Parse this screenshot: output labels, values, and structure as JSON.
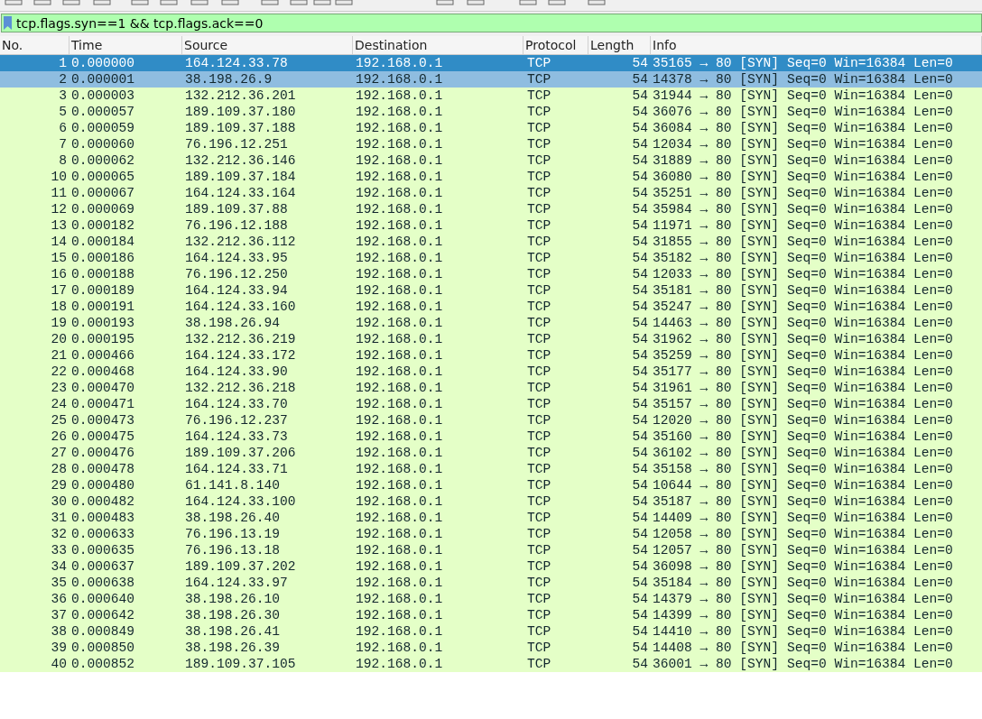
{
  "filter": {
    "value": "tcp.flags.syn==1 && tcp.flags.ack==0"
  },
  "packet_list": {
    "columns": [
      "No.",
      "Time",
      "Source",
      "Destination",
      "Protocol",
      "Length",
      "Info"
    ],
    "rows": [
      {
        "cells": [
          "1",
          "0.000000",
          "164.124.33.78",
          "192.168.0.1",
          "TCP",
          "54",
          "35165 → 80 [SYN] Seq=0 Win=16384 Len=0"
        ],
        "selected": true,
        "hovered": false
      },
      {
        "cells": [
          "2",
          "0.000001",
          "38.198.26.9",
          "192.168.0.1",
          "TCP",
          "54",
          "14378 → 80 [SYN] Seq=0 Win=16384 Len=0"
        ],
        "selected": false,
        "hovered": true
      },
      {
        "cells": [
          "3",
          "0.000003",
          "132.212.36.201",
          "192.168.0.1",
          "TCP",
          "54",
          "31944 → 80 [SYN] Seq=0 Win=16384 Len=0"
        ],
        "selected": false,
        "hovered": false
      },
      {
        "cells": [
          "5",
          "0.000057",
          "189.109.37.180",
          "192.168.0.1",
          "TCP",
          "54",
          "36076 → 80 [SYN] Seq=0 Win=16384 Len=0"
        ],
        "selected": false,
        "hovered": false
      },
      {
        "cells": [
          "6",
          "0.000059",
          "189.109.37.188",
          "192.168.0.1",
          "TCP",
          "54",
          "36084 → 80 [SYN] Seq=0 Win=16384 Len=0"
        ],
        "selected": false,
        "hovered": false
      },
      {
        "cells": [
          "7",
          "0.000060",
          "76.196.12.251",
          "192.168.0.1",
          "TCP",
          "54",
          "12034 → 80 [SYN] Seq=0 Win=16384 Len=0"
        ],
        "selected": false,
        "hovered": false
      },
      {
        "cells": [
          "8",
          "0.000062",
          "132.212.36.146",
          "192.168.0.1",
          "TCP",
          "54",
          "31889 → 80 [SYN] Seq=0 Win=16384 Len=0"
        ],
        "selected": false,
        "hovered": false
      },
      {
        "cells": [
          "10",
          "0.000065",
          "189.109.37.184",
          "192.168.0.1",
          "TCP",
          "54",
          "36080 → 80 [SYN] Seq=0 Win=16384 Len=0"
        ],
        "selected": false,
        "hovered": false
      },
      {
        "cells": [
          "11",
          "0.000067",
          "164.124.33.164",
          "192.168.0.1",
          "TCP",
          "54",
          "35251 → 80 [SYN] Seq=0 Win=16384 Len=0"
        ],
        "selected": false,
        "hovered": false
      },
      {
        "cells": [
          "12",
          "0.000069",
          "189.109.37.88",
          "192.168.0.1",
          "TCP",
          "54",
          "35984 → 80 [SYN] Seq=0 Win=16384 Len=0"
        ],
        "selected": false,
        "hovered": false
      },
      {
        "cells": [
          "13",
          "0.000182",
          "76.196.12.188",
          "192.168.0.1",
          "TCP",
          "54",
          "11971 → 80 [SYN] Seq=0 Win=16384 Len=0"
        ],
        "selected": false,
        "hovered": false
      },
      {
        "cells": [
          "14",
          "0.000184",
          "132.212.36.112",
          "192.168.0.1",
          "TCP",
          "54",
          "31855 → 80 [SYN] Seq=0 Win=16384 Len=0"
        ],
        "selected": false,
        "hovered": false
      },
      {
        "cells": [
          "15",
          "0.000186",
          "164.124.33.95",
          "192.168.0.1",
          "TCP",
          "54",
          "35182 → 80 [SYN] Seq=0 Win=16384 Len=0"
        ],
        "selected": false,
        "hovered": false
      },
      {
        "cells": [
          "16",
          "0.000188",
          "76.196.12.250",
          "192.168.0.1",
          "TCP",
          "54",
          "12033 → 80 [SYN] Seq=0 Win=16384 Len=0"
        ],
        "selected": false,
        "hovered": false
      },
      {
        "cells": [
          "17",
          "0.000189",
          "164.124.33.94",
          "192.168.0.1",
          "TCP",
          "54",
          "35181 → 80 [SYN] Seq=0 Win=16384 Len=0"
        ],
        "selected": false,
        "hovered": false
      },
      {
        "cells": [
          "18",
          "0.000191",
          "164.124.33.160",
          "192.168.0.1",
          "TCP",
          "54",
          "35247 → 80 [SYN] Seq=0 Win=16384 Len=0"
        ],
        "selected": false,
        "hovered": false
      },
      {
        "cells": [
          "19",
          "0.000193",
          "38.198.26.94",
          "192.168.0.1",
          "TCP",
          "54",
          "14463 → 80 [SYN] Seq=0 Win=16384 Len=0"
        ],
        "selected": false,
        "hovered": false
      },
      {
        "cells": [
          "20",
          "0.000195",
          "132.212.36.219",
          "192.168.0.1",
          "TCP",
          "54",
          "31962 → 80 [SYN] Seq=0 Win=16384 Len=0"
        ],
        "selected": false,
        "hovered": false
      },
      {
        "cells": [
          "21",
          "0.000466",
          "164.124.33.172",
          "192.168.0.1",
          "TCP",
          "54",
          "35259 → 80 [SYN] Seq=0 Win=16384 Len=0"
        ],
        "selected": false,
        "hovered": false
      },
      {
        "cells": [
          "22",
          "0.000468",
          "164.124.33.90",
          "192.168.0.1",
          "TCP",
          "54",
          "35177 → 80 [SYN] Seq=0 Win=16384 Len=0"
        ],
        "selected": false,
        "hovered": false
      },
      {
        "cells": [
          "23",
          "0.000470",
          "132.212.36.218",
          "192.168.0.1",
          "TCP",
          "54",
          "31961 → 80 [SYN] Seq=0 Win=16384 Len=0"
        ],
        "selected": false,
        "hovered": false
      },
      {
        "cells": [
          "24",
          "0.000471",
          "164.124.33.70",
          "192.168.0.1",
          "TCP",
          "54",
          "35157 → 80 [SYN] Seq=0 Win=16384 Len=0"
        ],
        "selected": false,
        "hovered": false
      },
      {
        "cells": [
          "25",
          "0.000473",
          "76.196.12.237",
          "192.168.0.1",
          "TCP",
          "54",
          "12020 → 80 [SYN] Seq=0 Win=16384 Len=0"
        ],
        "selected": false,
        "hovered": false
      },
      {
        "cells": [
          "26",
          "0.000475",
          "164.124.33.73",
          "192.168.0.1",
          "TCP",
          "54",
          "35160 → 80 [SYN] Seq=0 Win=16384 Len=0"
        ],
        "selected": false,
        "hovered": false
      },
      {
        "cells": [
          "27",
          "0.000476",
          "189.109.37.206",
          "192.168.0.1",
          "TCP",
          "54",
          "36102 → 80 [SYN] Seq=0 Win=16384 Len=0"
        ],
        "selected": false,
        "hovered": false
      },
      {
        "cells": [
          "28",
          "0.000478",
          "164.124.33.71",
          "192.168.0.1",
          "TCP",
          "54",
          "35158 → 80 [SYN] Seq=0 Win=16384 Len=0"
        ],
        "selected": false,
        "hovered": false
      },
      {
        "cells": [
          "29",
          "0.000480",
          "61.141.8.140",
          "192.168.0.1",
          "TCP",
          "54",
          "10644 → 80 [SYN] Seq=0 Win=16384 Len=0"
        ],
        "selected": false,
        "hovered": false
      },
      {
        "cells": [
          "30",
          "0.000482",
          "164.124.33.100",
          "192.168.0.1",
          "TCP",
          "54",
          "35187 → 80 [SYN] Seq=0 Win=16384 Len=0"
        ],
        "selected": false,
        "hovered": false
      },
      {
        "cells": [
          "31",
          "0.000483",
          "38.198.26.40",
          "192.168.0.1",
          "TCP",
          "54",
          "14409 → 80 [SYN] Seq=0 Win=16384 Len=0"
        ],
        "selected": false,
        "hovered": false
      },
      {
        "cells": [
          "32",
          "0.000633",
          "76.196.13.19",
          "192.168.0.1",
          "TCP",
          "54",
          "12058 → 80 [SYN] Seq=0 Win=16384 Len=0"
        ],
        "selected": false,
        "hovered": false
      },
      {
        "cells": [
          "33",
          "0.000635",
          "76.196.13.18",
          "192.168.0.1",
          "TCP",
          "54",
          "12057 → 80 [SYN] Seq=0 Win=16384 Len=0"
        ],
        "selected": false,
        "hovered": false
      },
      {
        "cells": [
          "34",
          "0.000637",
          "189.109.37.202",
          "192.168.0.1",
          "TCP",
          "54",
          "36098 → 80 [SYN] Seq=0 Win=16384 Len=0"
        ],
        "selected": false,
        "hovered": false
      },
      {
        "cells": [
          "35",
          "0.000638",
          "164.124.33.97",
          "192.168.0.1",
          "TCP",
          "54",
          "35184 → 80 [SYN] Seq=0 Win=16384 Len=0"
        ],
        "selected": false,
        "hovered": false
      },
      {
        "cells": [
          "36",
          "0.000640",
          "38.198.26.10",
          "192.168.0.1",
          "TCP",
          "54",
          "14379 → 80 [SYN] Seq=0 Win=16384 Len=0"
        ],
        "selected": false,
        "hovered": false
      },
      {
        "cells": [
          "37",
          "0.000642",
          "38.198.26.30",
          "192.168.0.1",
          "TCP",
          "54",
          "14399 → 80 [SYN] Seq=0 Win=16384 Len=0"
        ],
        "selected": false,
        "hovered": false
      },
      {
        "cells": [
          "38",
          "0.000849",
          "38.198.26.41",
          "192.168.0.1",
          "TCP",
          "54",
          "14410 → 80 [SYN] Seq=0 Win=16384 Len=0"
        ],
        "selected": false,
        "hovered": false
      },
      {
        "cells": [
          "39",
          "0.000850",
          "38.198.26.39",
          "192.168.0.1",
          "TCP",
          "54",
          "14408 → 80 [SYN] Seq=0 Win=16384 Len=0"
        ],
        "selected": false,
        "hovered": false
      },
      {
        "cells": [
          "40",
          "0.000852",
          "189.109.37.105",
          "192.168.0.1",
          "TCP",
          "54",
          "36001 → 80 [SYN] Seq=0 Win=16384 Len=0"
        ],
        "selected": false,
        "hovered": false
      }
    ]
  }
}
